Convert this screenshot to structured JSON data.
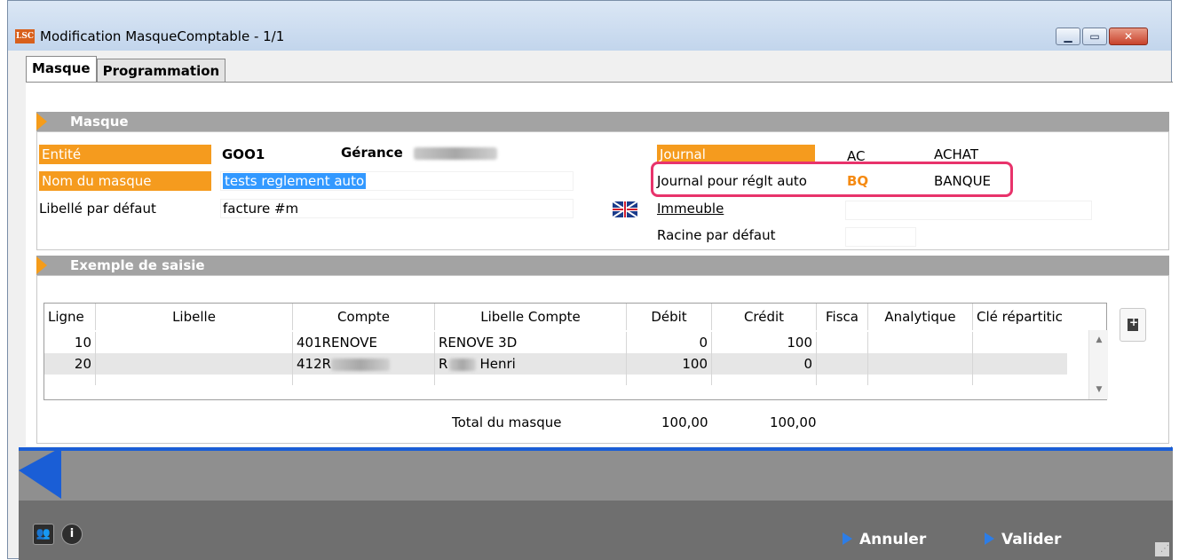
{
  "window": {
    "logo_text": "LSC",
    "title": "Modification MasqueComptable - 1/1"
  },
  "tabs": [
    {
      "label": "Masque"
    },
    {
      "label": "Programmation"
    }
  ],
  "masque_section": {
    "title": "Masque",
    "entite_label": "Entité",
    "entite_value": "GOO1",
    "gerance_label": "Gérance",
    "nom_label": "Nom du masque",
    "nom_value": "tests reglement auto",
    "libelle_label": "Libellé par défaut",
    "libelle_value": "facture #m",
    "journal_label": "Journal",
    "journal_code": "AC",
    "journal_name": "ACHAT",
    "journal_auto_label": "Journal pour réglt auto",
    "journal_auto_code": "BQ",
    "journal_auto_name": "BANQUE",
    "immeuble_label": "Immeuble",
    "racine_label": "Racine par défaut"
  },
  "exemple_section": {
    "title": "Exemple de saisie",
    "columns": [
      "Ligne",
      "Libelle",
      "Compte",
      "Libelle Compte",
      "Débit",
      "Crédit",
      "Fisca",
      "Analytique",
      "Clé répartitic"
    ],
    "rows": [
      {
        "ligne": "10",
        "libelle": "",
        "compte": "401RENOVE",
        "libelle_compte": "RENOVE 3D",
        "debit": "0",
        "credit": "100"
      },
      {
        "ligne": "20",
        "libelle": "",
        "compte": "412R",
        "libelle_compte_prefix": "R",
        "libelle_compte": "Henri",
        "debit": "100",
        "credit": "0"
      }
    ],
    "total_label": "Total du masque",
    "total_debit": "100,00",
    "total_credit": "100,00"
  },
  "footer": {
    "annuler_label": "Annuler",
    "valider_label": "Valider"
  },
  "colors": {
    "accent_orange": "#f59b1e",
    "highlight_pink": "#e8336b",
    "accent_blue": "#1a5ed6"
  }
}
